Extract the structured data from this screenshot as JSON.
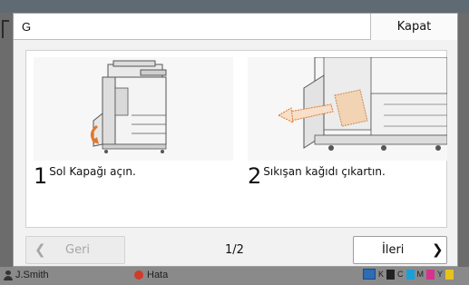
{
  "dialog": {
    "title": "G",
    "close_label": "Kapat"
  },
  "steps": [
    {
      "number": "1",
      "text": "Sol Kapağı açın."
    },
    {
      "number": "2",
      "text": "Sıkışan kağıdı çıkartın."
    }
  ],
  "footer": {
    "prev_label": "Geri",
    "page_indicator": "1/2",
    "next_label": "İleri"
  },
  "status_bar": {
    "user": "J.Smith",
    "error_text": "Hata",
    "ink_labels": [
      "K",
      "C",
      "M",
      "Y"
    ],
    "ink_colors": [
      "#222222",
      "#1aa0d8",
      "#d6338f",
      "#e8c21a"
    ]
  },
  "colors": {
    "dialog_bg": "#f2f2f2",
    "accent_orange": "#e0782a",
    "error_red": "#d23a2a"
  }
}
